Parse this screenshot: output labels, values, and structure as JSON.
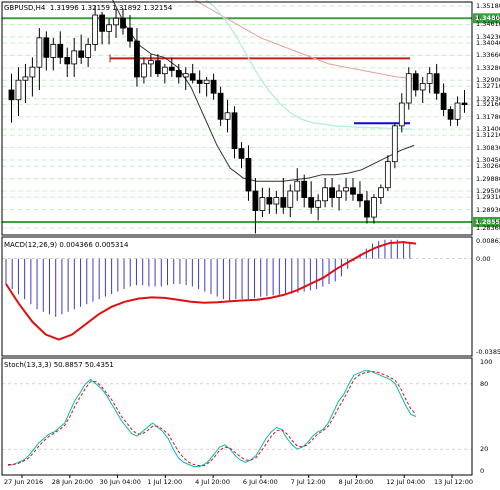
{
  "header": {
    "symbol": "GBPUSD,H4",
    "ohlc": "1.31996 1.32159 1.31892 1.32154"
  },
  "colors": {
    "background": "#ffffff",
    "grid": "#c8f0c8",
    "level": "#3ca03c",
    "resistance": "#c81e1e",
    "support": "#0a0acc",
    "ma_fast": "#b8ecdf",
    "ma_slow": "#e8a09a",
    "ma_mid": "#303030",
    "macd_hist": "#3c3cc8",
    "macd_signal": "#dd1111",
    "stoch_main": "#00b8b8",
    "stoch_signal": "#dd1111"
  },
  "chart_data": [
    {
      "type": "candlestick",
      "title": "GBPUSD,H4 1.31996 1.32159 1.31892 1.32154",
      "price_ticks": [
        "1.35180",
        "1.34800",
        "1.34610",
        "1.34230",
        "1.34040",
        "1.33660",
        "1.33280",
        "1.32900",
        "1.32710",
        "1.32330",
        "1.32160",
        "1.31780",
        "1.31400",
        "1.31210",
        "1.30830",
        "1.30450",
        "1.30260",
        "1.29880",
        "1.29500",
        "1.29310",
        "1.28930",
        "1.28550",
        "1.28360"
      ],
      "horizontal_levels": [
        {
          "name": "upper level",
          "value": 1.348,
          "label": "1.34800"
        },
        {
          "name": "resistance",
          "value": 1.3357
        },
        {
          "name": "support",
          "value": 1.3158
        },
        {
          "name": "lower level",
          "value": 1.2855,
          "label": "1.28550"
        }
      ],
      "x_labels": [
        "27 Jun 2016",
        "28 Jun 20:00",
        "30 Jun 04:00",
        "1 Jul 12:00",
        "4 Jul 20:00",
        "6 Jul 04:00",
        "7 Jul 12:00",
        "8 Jul 20:00",
        "12 Jul 04:00",
        "13 Jul 12:00"
      ],
      "candles": [
        [
          1.326,
          1.331,
          1.316,
          1.323
        ],
        [
          1.323,
          1.333,
          1.318,
          1.329
        ],
        [
          1.329,
          1.334,
          1.322,
          1.33
        ],
        [
          1.33,
          1.336,
          1.324,
          1.333
        ],
        [
          1.333,
          1.345,
          1.326,
          1.342
        ],
        [
          1.342,
          1.344,
          1.332,
          1.336
        ],
        [
          1.336,
          1.342,
          1.332,
          1.34
        ],
        [
          1.34,
          1.344,
          1.334,
          1.336
        ],
        [
          1.336,
          1.339,
          1.33,
          1.334
        ],
        [
          1.334,
          1.342,
          1.33,
          1.338
        ],
        [
          1.338,
          1.343,
          1.334,
          1.336
        ],
        [
          1.336,
          1.342,
          1.333,
          1.34
        ],
        [
          1.34,
          1.352,
          1.338,
          1.349
        ],
        [
          1.349,
          1.35,
          1.34,
          1.344
        ],
        [
          1.344,
          1.348,
          1.34,
          1.346
        ],
        [
          1.346,
          1.351,
          1.342,
          1.348
        ],
        [
          1.348,
          1.351,
          1.343,
          1.345
        ],
        [
          1.345,
          1.349,
          1.339,
          1.341
        ],
        [
          1.341,
          1.345,
          1.327,
          1.33
        ],
        [
          1.33,
          1.336,
          1.328,
          1.334
        ],
        [
          1.334,
          1.337,
          1.33,
          1.335
        ],
        [
          1.335,
          1.337,
          1.33,
          1.331
        ],
        [
          1.331,
          1.334,
          1.328,
          1.333
        ],
        [
          1.333,
          1.336,
          1.33,
          1.332
        ],
        [
          1.332,
          1.334,
          1.328,
          1.33
        ],
        [
          1.33,
          1.333,
          1.326,
          1.331
        ],
        [
          1.331,
          1.334,
          1.328,
          1.329
        ],
        [
          1.329,
          1.332,
          1.325,
          1.328
        ],
        [
          1.328,
          1.33,
          1.324,
          1.329
        ],
        [
          1.329,
          1.331,
          1.323,
          1.325
        ],
        [
          1.325,
          1.327,
          1.315,
          1.317
        ],
        [
          1.317,
          1.323,
          1.313,
          1.319
        ],
        [
          1.319,
          1.321,
          1.305,
          1.308
        ],
        [
          1.308,
          1.31,
          1.302,
          1.305
        ],
        [
          1.305,
          1.309,
          1.292,
          1.295
        ],
        [
          1.295,
          1.299,
          1.282,
          1.289
        ],
        [
          1.289,
          1.296,
          1.287,
          1.293
        ],
        [
          1.293,
          1.296,
          1.288,
          1.291
        ],
        [
          1.291,
          1.295,
          1.288,
          1.293
        ],
        [
          1.293,
          1.299,
          1.288,
          1.29
        ],
        [
          1.29,
          1.297,
          1.287,
          1.295
        ],
        [
          1.295,
          1.302,
          1.292,
          1.298
        ],
        [
          1.298,
          1.3,
          1.29,
          1.293
        ],
        [
          1.293,
          1.298,
          1.288,
          1.29
        ],
        [
          1.29,
          1.294,
          1.286,
          1.292
        ],
        [
          1.292,
          1.299,
          1.29,
          1.296
        ],
        [
          1.296,
          1.299,
          1.29,
          1.293
        ],
        [
          1.293,
          1.297,
          1.289,
          1.295
        ],
        [
          1.295,
          1.299,
          1.292,
          1.296
        ],
        [
          1.296,
          1.299,
          1.292,
          1.294
        ],
        [
          1.294,
          1.298,
          1.29,
          1.292
        ],
        [
          1.292,
          1.295,
          1.285,
          1.287
        ],
        [
          1.287,
          1.294,
          1.285,
          1.293
        ],
        [
          1.293,
          1.297,
          1.291,
          1.296
        ],
        [
          1.296,
          1.306,
          1.295,
          1.304
        ],
        [
          1.304,
          1.316,
          1.302,
          1.315
        ],
        [
          1.315,
          1.325,
          1.313,
          1.322
        ],
        [
          1.322,
          1.333,
          1.32,
          1.331
        ],
        [
          1.331,
          1.332,
          1.324,
          1.326
        ],
        [
          1.326,
          1.33,
          1.322,
          1.328
        ],
        [
          1.328,
          1.333,
          1.325,
          1.331
        ],
        [
          1.331,
          1.334,
          1.323,
          1.325
        ],
        [
          1.325,
          1.328,
          1.318,
          1.32
        ],
        [
          1.32,
          1.321,
          1.315,
          1.317
        ],
        [
          1.317,
          1.324,
          1.315,
          1.322
        ],
        [
          1.322,
          1.326,
          1.319,
          1.3215
        ]
      ],
      "moving_averages": [
        {
          "name": "slow",
          "values": [
            1.392,
            1.388,
            1.384,
            1.38,
            1.376,
            1.372,
            1.368,
            1.364,
            1.36,
            1.357,
            1.354,
            1.351,
            1.348,
            1.345,
            1.342,
            1.34,
            1.338,
            1.336,
            1.334,
            1.333,
            1.332,
            1.331,
            1.33,
            1.3295
          ]
        },
        {
          "name": "fast",
          "values": [
            1.3545,
            1.352,
            1.348,
            1.343,
            1.337,
            1.331,
            1.326,
            1.322,
            1.319,
            1.317,
            1.316,
            1.3155,
            1.315,
            1.3148,
            1.3146,
            1.3145,
            1.3144,
            1.3142,
            1.3141,
            1.314
          ]
        },
        {
          "name": "mid",
          "values": [
            1.354,
            1.346,
            1.34,
            1.337,
            1.336,
            1.333,
            1.327,
            1.318,
            1.309,
            1.302,
            1.299,
            1.298,
            1.298,
            1.298,
            1.2985,
            1.299,
            1.3,
            1.3,
            1.3005,
            1.3015,
            1.3035,
            1.3055,
            1.3075,
            1.309
          ]
        }
      ]
    },
    {
      "type": "bar",
      "title": "MACD(12,26,9) 0.004366 0.005314",
      "ticks": [
        "0.008637",
        "0.00",
        "-0.038525"
      ],
      "ylim": [
        -0.0385,
        0.0086
      ],
      "histogram": [
        -0.01,
        -0.012,
        -0.014,
        -0.016,
        -0.018,
        -0.02,
        -0.021,
        -0.022,
        -0.023,
        -0.022,
        -0.021,
        -0.02,
        -0.019,
        -0.018,
        -0.017,
        -0.016,
        -0.015,
        -0.014,
        -0.013,
        -0.012,
        -0.011,
        -0.0105,
        -0.0105,
        -0.011,
        -0.011,
        -0.011,
        -0.0105,
        -0.01,
        -0.01,
        -0.0105,
        -0.011,
        -0.012,
        -0.013,
        -0.014,
        -0.015,
        -0.016,
        -0.017,
        -0.016,
        -0.016,
        -0.016,
        -0.0155,
        -0.015,
        -0.0148,
        -0.0145,
        -0.0142,
        -0.014,
        -0.0138,
        -0.0135,
        -0.013,
        -0.0125,
        -0.012,
        -0.011,
        -0.01,
        -0.009,
        -0.007,
        -0.004,
        -0.001,
        0.002,
        0.004,
        0.006,
        0.007,
        0.0075,
        0.0075,
        0.0075,
        0.007,
        0.0065
      ],
      "signal": [
        -0.01,
        -0.018,
        -0.025,
        -0.03,
        -0.032,
        -0.03,
        -0.026,
        -0.022,
        -0.019,
        -0.017,
        -0.0158,
        -0.0153,
        -0.0155,
        -0.0162,
        -0.017,
        -0.0174,
        -0.0172,
        -0.0168,
        -0.0165,
        -0.0162,
        -0.0155,
        -0.0143,
        -0.0125,
        -0.01,
        -0.0075,
        -0.004,
        -0.001,
        0.002,
        0.0045,
        0.0062,
        0.0066,
        0.006
      ]
    },
    {
      "type": "line",
      "title": "Stoch(13,3,3) 50.8857 50.4351",
      "ticks": [
        "100",
        "80",
        "20",
        "0"
      ],
      "ylim": [
        0,
        100
      ],
      "series": [
        {
          "name": "main",
          "values": [
            5,
            6,
            8,
            10,
            14,
            20,
            26,
            30,
            34,
            36,
            40,
            44,
            55,
            65,
            72,
            80,
            84,
            80,
            76,
            70,
            62,
            54,
            46,
            40,
            34,
            32,
            36,
            40,
            44,
            40,
            36,
            30,
            20,
            12,
            8,
            6,
            4,
            4,
            6,
            10,
            16,
            22,
            24,
            20,
            14,
            10,
            8,
            10,
            14,
            22,
            30,
            36,
            40,
            38,
            30,
            24,
            20,
            22,
            26,
            32,
            36,
            38,
            44,
            54,
            64,
            70,
            80,
            88,
            90,
            92,
            92,
            90,
            88,
            86,
            84,
            80,
            70,
            60,
            52,
            50
          ]
        },
        {
          "name": "signal",
          "values": [
            6,
            6,
            7,
            9,
            12,
            17,
            23,
            28,
            32,
            35,
            38,
            42,
            50,
            60,
            68,
            76,
            82,
            82,
            78,
            72,
            66,
            58,
            50,
            44,
            38,
            34,
            34,
            37,
            41,
            41,
            38,
            34,
            26,
            18,
            12,
            8,
            6,
            5,
            5,
            8,
            13,
            19,
            22,
            21,
            17,
            13,
            10,
            10,
            12,
            18,
            25,
            32,
            37,
            38,
            34,
            28,
            23,
            22,
            24,
            29,
            34,
            37,
            41,
            49,
            58,
            66,
            75,
            84,
            88,
            90,
            91,
            91,
            90,
            88,
            86,
            83,
            76,
            66,
            57,
            52
          ]
        }
      ]
    }
  ]
}
